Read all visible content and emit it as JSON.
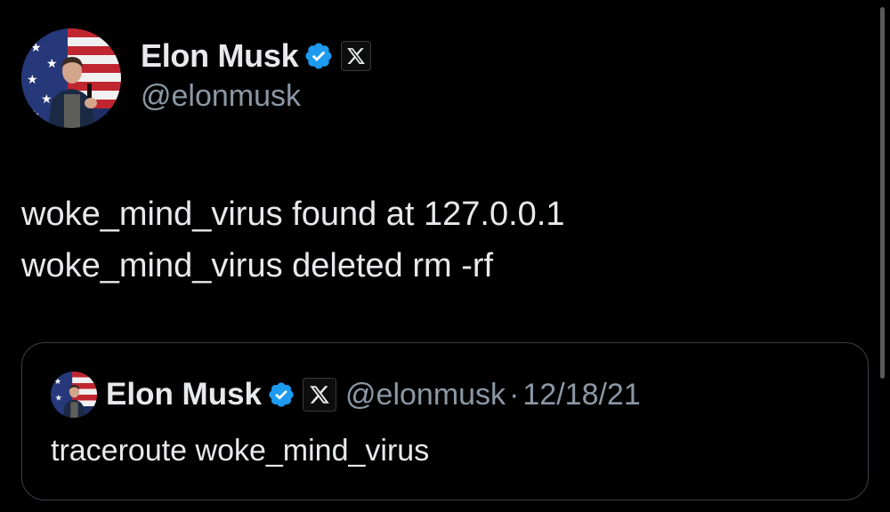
{
  "tweet": {
    "author": {
      "display_name": "Elon Musk",
      "handle": "@elonmusk",
      "verified_icon": "verified-badge-icon",
      "affiliation_icon": "x-logo-icon"
    },
    "text_lines": [
      "woke_mind_virus found at 127.0.0.1",
      "woke_mind_virus deleted rm -rf"
    ]
  },
  "quoted_tweet": {
    "author": {
      "display_name": "Elon Musk",
      "handle": "@elonmusk"
    },
    "separator": "·",
    "date": "12/18/21",
    "text": "traceroute woke_mind_virus"
  },
  "colors": {
    "background": "#000000",
    "primary_text": "#e7e9ea",
    "secondary_text": "#8b98a5",
    "verified_blue": "#1d9bf0",
    "card_border": "#3b3f44"
  }
}
